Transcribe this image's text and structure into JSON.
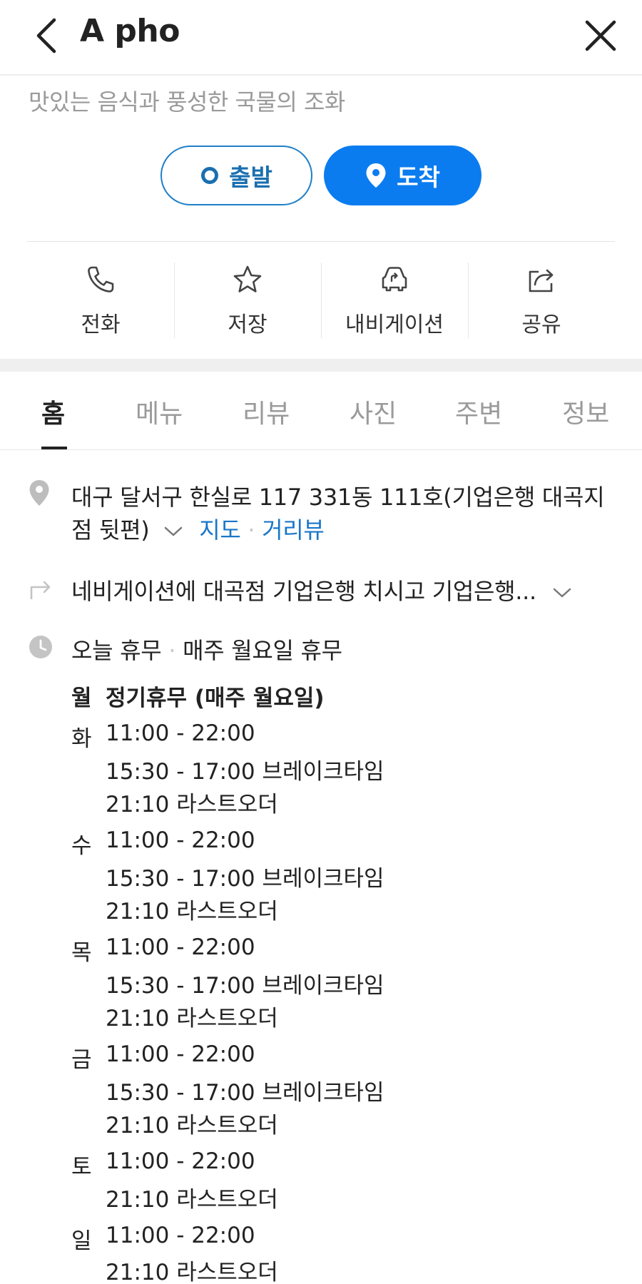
{
  "header": {
    "title": "A pho"
  },
  "description": "맛있는 음식과 풍성한 국물의 조화",
  "route": {
    "start_label": "출발",
    "arrive_label": "도착"
  },
  "actions": [
    {
      "label": "전화",
      "icon": "phone-icon"
    },
    {
      "label": "저장",
      "icon": "star-icon"
    },
    {
      "label": "내비게이션",
      "icon": "navigation-car-icon"
    },
    {
      "label": "공유",
      "icon": "share-icon"
    }
  ],
  "tabs": [
    "홈",
    "메뉴",
    "리뷰",
    "사진",
    "주변",
    "정보"
  ],
  "address": {
    "line1": "대구 달서구 한실로 117 331동 111호(기업은행 대곡지",
    "line2": "점 뒷편)",
    "map_link": "지도",
    "street_view_link": "거리뷰"
  },
  "directions": "네비게이션에 대곡점 기업은행 치시고 기업은행...",
  "hours": {
    "today_status": "오늘 휴무",
    "today_note": "매주 월요일 휴무",
    "schedule": [
      {
        "day": "월",
        "lines": [
          "정기휴무 (매주 월요일)"
        ]
      },
      {
        "day": "화",
        "lines": [
          "11:00 - 22:00",
          "15:30 - 17:00 브레이크타임",
          "21:10 라스트오더"
        ]
      },
      {
        "day": "수",
        "lines": [
          "11:00 - 22:00",
          "15:30 - 17:00 브레이크타임",
          "21:10 라스트오더"
        ]
      },
      {
        "day": "목",
        "lines": [
          "11:00 - 22:00",
          "15:30 - 17:00 브레이크타임",
          "21:10 라스트오더"
        ]
      },
      {
        "day": "금",
        "lines": [
          "11:00 - 22:00",
          "15:30 - 17:00 브레이크타임",
          "21:10 라스트오더"
        ]
      },
      {
        "day": "토",
        "lines": [
          "11:00 - 22:00",
          "21:10 라스트오더"
        ]
      },
      {
        "day": "일",
        "lines": [
          "11:00 - 22:00",
          "21:10 라스트오더"
        ]
      }
    ]
  },
  "colors": {
    "accent": "#0a7cf0",
    "link": "#1976c8",
    "muted": "#9a9a9a"
  }
}
